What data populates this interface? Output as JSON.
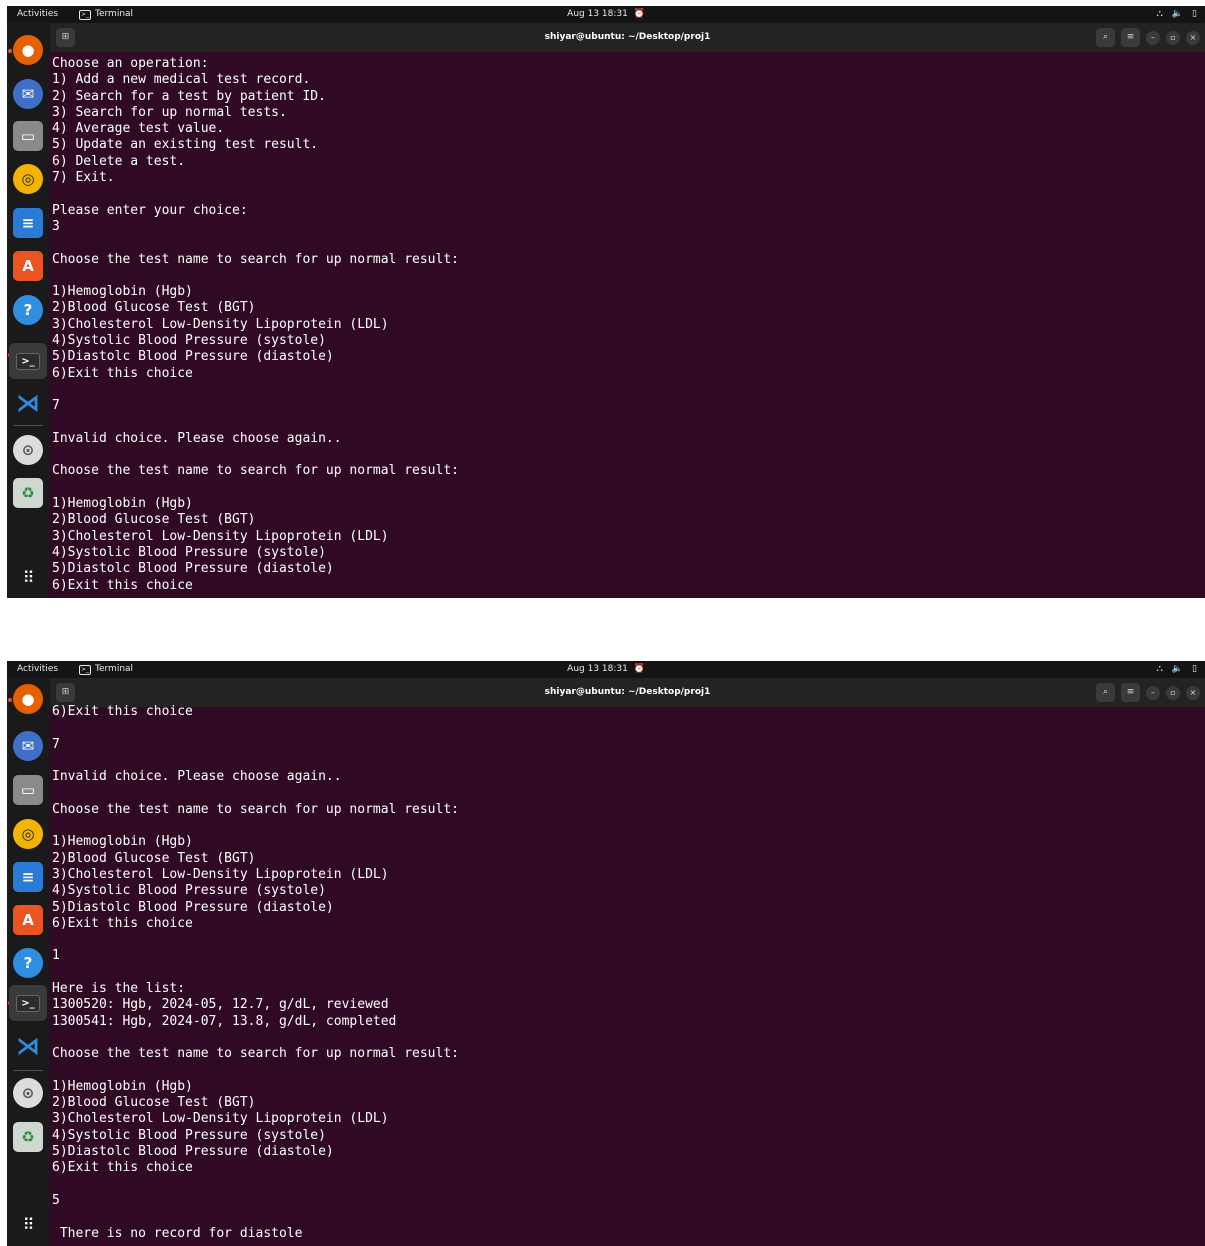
{
  "screens": [
    {
      "topbar": {
        "activities": "Activities",
        "app": "Terminal",
        "clock": "Aug 13  18:31"
      },
      "window": {
        "title": "shiyar@ubuntu: ~/Desktop/proj1"
      },
      "terminal_lines": [
        "Choose an operation:",
        "1) Add a new medical test record.",
        "2) Search for a test by patient ID.",
        "3) Search for up normal tests.",
        "4) Average test value.",
        "5) Update an existing test result.",
        "6) Delete a test.",
        "7) Exit.",
        "",
        "Please enter your choice:",
        "3",
        "",
        "Choose the test name to search for up normal result:",
        "",
        "1)Hemoglobin (Hgb)",
        "2)Blood Glucose Test (BGT)",
        "3)Cholesterol Low-Density Lipoprotein (LDL)",
        "4)Systolic Blood Pressure (systole)",
        "5)Diastolc Blood Pressure (diastole)",
        "6)Exit this choice",
        "",
        "7",
        "",
        "Invalid choice. Please choose again..",
        "",
        "Choose the test name to search for up normal result:",
        "",
        "1)Hemoglobin (Hgb)",
        "2)Blood Glucose Test (BGT)",
        "3)Cholesterol Low-Density Lipoprotein (LDL)",
        "4)Systolic Blood Pressure (systole)",
        "5)Diastolc Blood Pressure (diastole)",
        "6)Exit this choice"
      ]
    },
    {
      "topbar": {
        "activities": "Activities",
        "app": "Terminal",
        "clock": "Aug 13  18:31"
      },
      "window": {
        "title": "shiyar@ubuntu: ~/Desktop/proj1"
      },
      "terminal_lines": [
        "6)Exit this choice",
        "",
        "7",
        "",
        "Invalid choice. Please choose again..",
        "",
        "Choose the test name to search for up normal result:",
        "",
        "1)Hemoglobin (Hgb)",
        "2)Blood Glucose Test (BGT)",
        "3)Cholesterol Low-Density Lipoprotein (LDL)",
        "4)Systolic Blood Pressure (systole)",
        "5)Diastolc Blood Pressure (diastole)",
        "6)Exit this choice",
        "",
        "1",
        "",
        "Here is the list:",
        "1300520: Hgb, 2024-05, 12.7, g/dL, reviewed",
        "1300541: Hgb, 2024-07, 13.8, g/dL, completed",
        "",
        "Choose the test name to search for up normal result:",
        "",
        "1)Hemoglobin (Hgb)",
        "2)Blood Glucose Test (BGT)",
        "3)Cholesterol Low-Density Lipoprotein (LDL)",
        "4)Systolic Blood Pressure (systole)",
        "5)Diastolc Blood Pressure (diastole)",
        "6)Exit this choice",
        "",
        "5",
        "",
        " There is no record for diastole"
      ]
    }
  ],
  "dock": {
    "icons": [
      "firefox-icon",
      "thunderbird-icon",
      "files-icon",
      "rhythmbox-icon",
      "writer-icon",
      "software-icon",
      "help-icon",
      "terminal-icon",
      "vscode-icon",
      "disc-icon",
      "trash-icon",
      "app-grid-icon"
    ]
  },
  "colors": {
    "terminal_bg": "#300a24",
    "terminal_fg": "#ffffff",
    "ubuntu_orange": "#e95420"
  }
}
